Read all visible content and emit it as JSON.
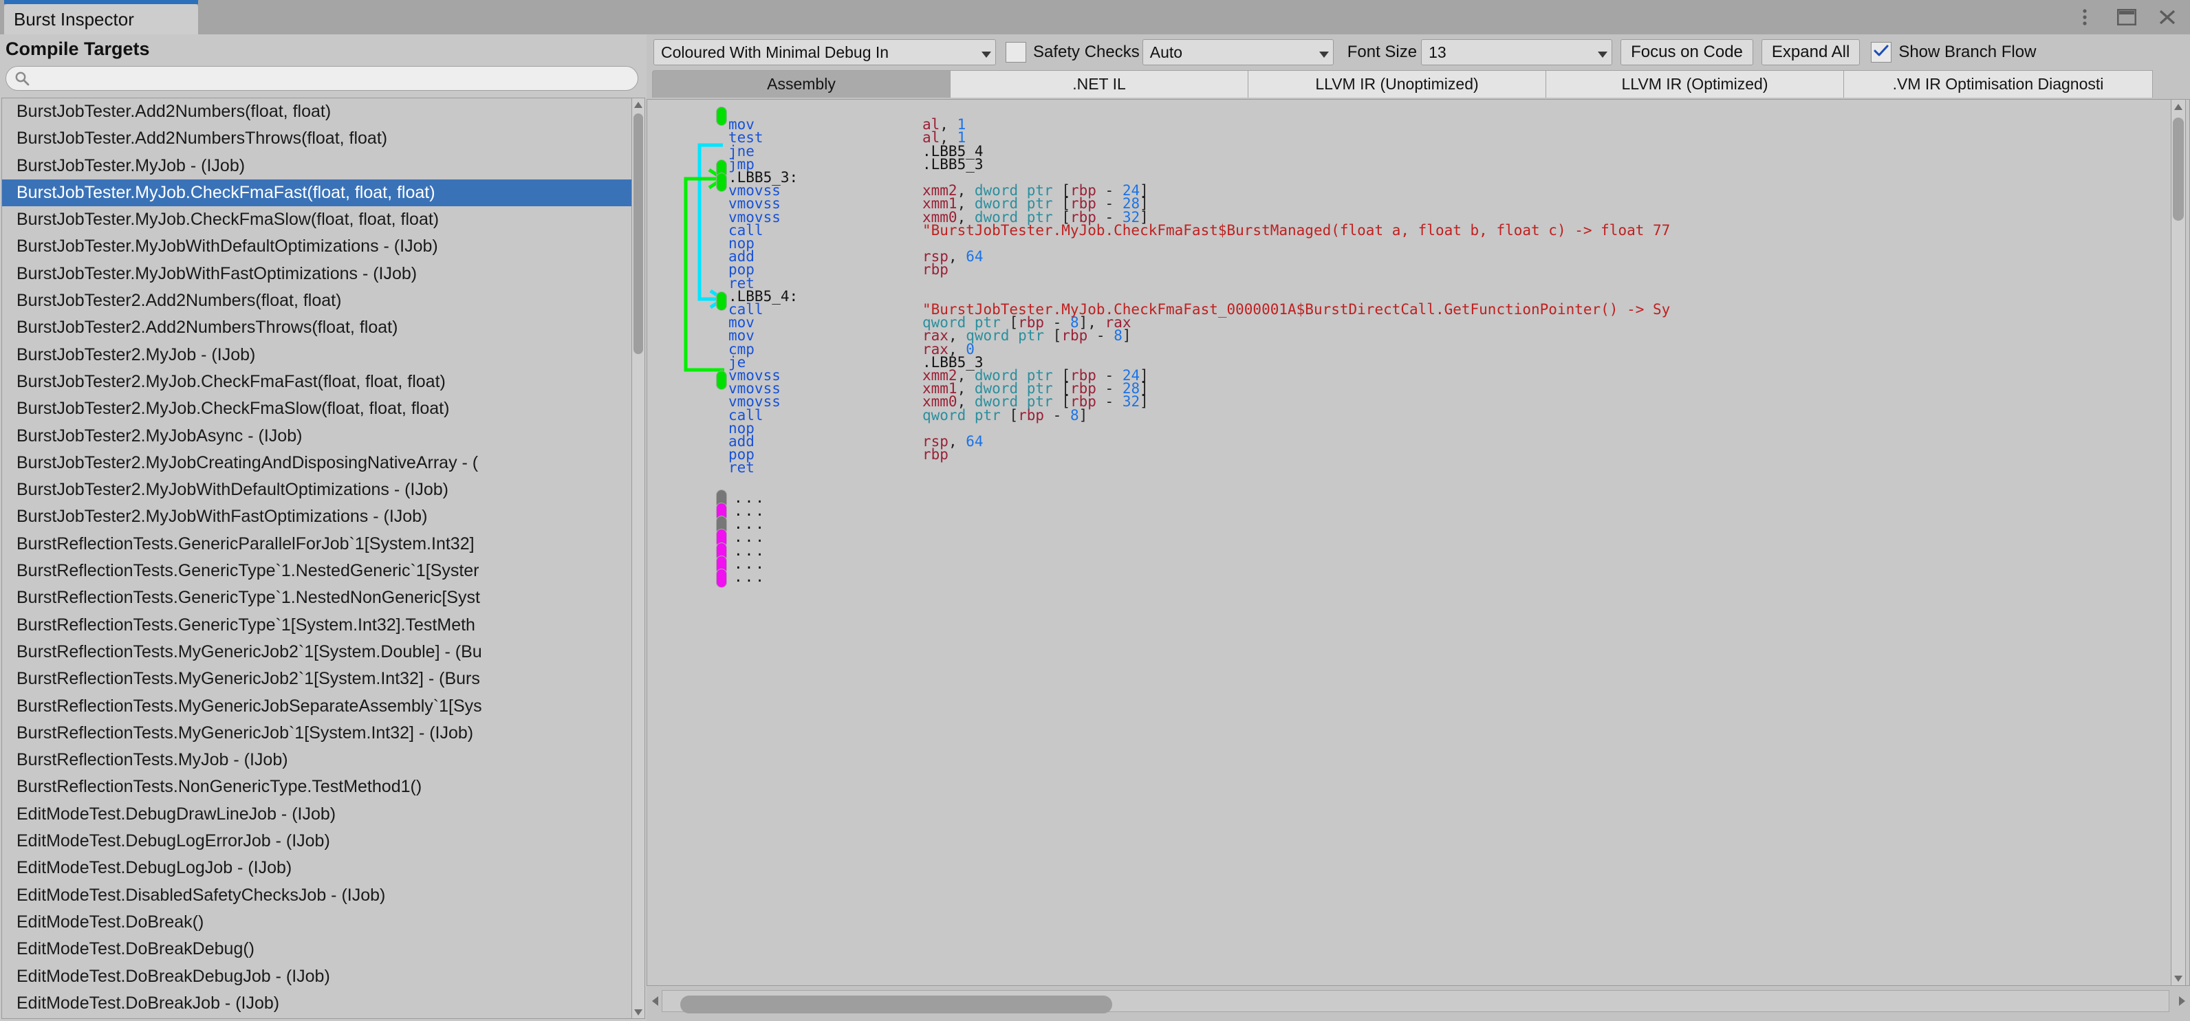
{
  "window": {
    "tab_title": "Burst Inspector",
    "buttons": [
      {
        "name": "kebab-menu",
        "icon": "kebab-menu-icon"
      },
      {
        "name": "maximize",
        "icon": "maximize-icon"
      },
      {
        "name": "close",
        "icon": "close-icon"
      }
    ]
  },
  "sidebar": {
    "title": "Compile Targets",
    "search": {
      "value": "",
      "placeholder": "",
      "icon": "search-icon"
    },
    "selected_index": 3,
    "items": [
      "BurstJobTester.Add2Numbers(float, float)",
      "BurstJobTester.Add2NumbersThrows(float, float)",
      "BurstJobTester.MyJob - (IJob)",
      "BurstJobTester.MyJob.CheckFmaFast(float, float, float)",
      "BurstJobTester.MyJob.CheckFmaSlow(float, float, float)",
      "BurstJobTester.MyJobWithDefaultOptimizations - (IJob)",
      "BurstJobTester.MyJobWithFastOptimizations - (IJob)",
      "BurstJobTester2.Add2Numbers(float, float)",
      "BurstJobTester2.Add2NumbersThrows(float, float)",
      "BurstJobTester2.MyJob - (IJob)",
      "BurstJobTester2.MyJob.CheckFmaFast(float, float, float)",
      "BurstJobTester2.MyJob.CheckFmaSlow(float, float, float)",
      "BurstJobTester2.MyJobAsync - (IJob)",
      "BurstJobTester2.MyJobCreatingAndDisposingNativeArray - (",
      "BurstJobTester2.MyJobWithDefaultOptimizations - (IJob)",
      "BurstJobTester2.MyJobWithFastOptimizations - (IJob)",
      "BurstReflectionTests.GenericParallelForJob`1[System.Int32]",
      "BurstReflectionTests.GenericType`1.NestedGeneric`1[Syster",
      "BurstReflectionTests.GenericType`1.NestedNonGeneric[Syst",
      "BurstReflectionTests.GenericType`1[System.Int32].TestMeth",
      "BurstReflectionTests.MyGenericJob2`1[System.Double] - (Bu",
      "BurstReflectionTests.MyGenericJob2`1[System.Int32] - (Burs",
      "BurstReflectionTests.MyGenericJobSeparateAssembly`1[Sys",
      "BurstReflectionTests.MyGenericJob`1[System.Int32] - (IJob)",
      "BurstReflectionTests.MyJob - (IJob)",
      "BurstReflectionTests.NonGenericType.TestMethod1()",
      "EditModeTest.DebugDrawLineJob - (IJob)",
      "EditModeTest.DebugLogErrorJob - (IJob)",
      "EditModeTest.DebugLogJob - (IJob)",
      "EditModeTest.DisabledSafetyChecksJob - (IJob)",
      "EditModeTest.DoBreak()",
      "EditModeTest.DoBreakDebug()",
      "EditModeTest.DoBreakDebugJob - (IJob)",
      "EditModeTest.DoBreakJob - (IJob)"
    ]
  },
  "toolbar": {
    "mode_dropdown": {
      "value": "Coloured With Minimal Debug In",
      "caret": "chevron-down-icon"
    },
    "safety_checks": {
      "label": "Safety Checks",
      "checked": false
    },
    "safety_dropdown": {
      "value": "Auto",
      "caret": "chevron-down-icon"
    },
    "font_size": {
      "label": "Font Size",
      "value": "13",
      "caret": "chevron-down-icon"
    },
    "focus_on_code": "Focus on Code",
    "expand_all": "Expand All",
    "show_branch_flow": {
      "label": "Show Branch Flow",
      "checked": true
    }
  },
  "ir_tabs": {
    "active_index": 0,
    "items": [
      "Assembly",
      ".NET IL",
      "LLVM IR (Unoptimized)",
      "LLVM IR (Optimized)",
      ".VM IR Optimisation Diagnosti"
    ]
  },
  "code": {
    "lines": [
      {
        "pill": "green",
        "kind": "blank"
      },
      {
        "kind": "instr",
        "mnemonic": "mov",
        "operands": [
          {
            "t": "reg",
            "v": "al"
          },
          {
            "t": "punc",
            "v": ", "
          },
          {
            "t": "num",
            "v": "1"
          }
        ]
      },
      {
        "kind": "instr",
        "mnemonic": "test",
        "operands": [
          {
            "t": "reg",
            "v": "al"
          },
          {
            "t": "punc",
            "v": ", "
          },
          {
            "t": "num",
            "v": "1"
          }
        ]
      },
      {
        "kind": "instr",
        "mnemonic": "jne",
        "operands": [
          {
            "t": "lbl",
            "v": ".LBB5_4"
          }
        ]
      },
      {
        "pill": "green",
        "kind": "instr",
        "mnemonic": "jmp",
        "operands": [
          {
            "t": "lbl",
            "v": ".LBB5_3"
          }
        ]
      },
      {
        "pill": "green",
        "kind": "label",
        "label": ".LBB5_3:"
      },
      {
        "kind": "instr",
        "mnemonic": "vmovss",
        "operands": [
          {
            "t": "reg",
            "v": "xmm2"
          },
          {
            "t": "punc",
            "v": ", "
          },
          {
            "t": "ptr",
            "v": "dword ptr "
          },
          {
            "t": "punc",
            "v": "["
          },
          {
            "t": "reg",
            "v": "rbp"
          },
          {
            "t": "punc",
            "v": " - "
          },
          {
            "t": "num",
            "v": "24"
          },
          {
            "t": "punc",
            "v": "]"
          }
        ]
      },
      {
        "kind": "instr",
        "mnemonic": "vmovss",
        "operands": [
          {
            "t": "reg",
            "v": "xmm1"
          },
          {
            "t": "punc",
            "v": ", "
          },
          {
            "t": "ptr",
            "v": "dword ptr "
          },
          {
            "t": "punc",
            "v": "["
          },
          {
            "t": "reg",
            "v": "rbp"
          },
          {
            "t": "punc",
            "v": " - "
          },
          {
            "t": "num",
            "v": "28"
          },
          {
            "t": "punc",
            "v": "]"
          }
        ]
      },
      {
        "kind": "instr",
        "mnemonic": "vmovss",
        "operands": [
          {
            "t": "reg",
            "v": "xmm0"
          },
          {
            "t": "punc",
            "v": ", "
          },
          {
            "t": "ptr",
            "v": "dword ptr "
          },
          {
            "t": "punc",
            "v": "["
          },
          {
            "t": "reg",
            "v": "rbp"
          },
          {
            "t": "punc",
            "v": " - "
          },
          {
            "t": "num",
            "v": "32"
          },
          {
            "t": "punc",
            "v": "]"
          }
        ]
      },
      {
        "kind": "instr",
        "mnemonic": "call",
        "operands": [
          {
            "t": "str",
            "v": "\"BurstJobTester.MyJob.CheckFmaFast$BurstManaged(float a, float b, float c) -> float 77"
          }
        ]
      },
      {
        "kind": "instr",
        "mnemonic": "nop",
        "operands": []
      },
      {
        "kind": "instr",
        "mnemonic": "add",
        "operands": [
          {
            "t": "reg",
            "v": "rsp"
          },
          {
            "t": "punc",
            "v": ", "
          },
          {
            "t": "num",
            "v": "64"
          }
        ]
      },
      {
        "kind": "instr",
        "mnemonic": "pop",
        "operands": [
          {
            "t": "reg",
            "v": "rbp"
          }
        ]
      },
      {
        "kind": "instr",
        "mnemonic": "ret",
        "operands": []
      },
      {
        "pill": "green",
        "kind": "label",
        "label": ".LBB5_4:"
      },
      {
        "kind": "instr",
        "mnemonic": "call",
        "operands": [
          {
            "t": "str",
            "v": "\"BurstJobTester.MyJob.CheckFmaFast_0000001A$BurstDirectCall.GetFunctionPointer() -> Sy"
          }
        ]
      },
      {
        "kind": "instr",
        "mnemonic": "mov",
        "operands": [
          {
            "t": "ptr",
            "v": "qword ptr "
          },
          {
            "t": "punc",
            "v": "["
          },
          {
            "t": "reg",
            "v": "rbp"
          },
          {
            "t": "punc",
            "v": " - "
          },
          {
            "t": "num",
            "v": "8"
          },
          {
            "t": "punc",
            "v": "], "
          },
          {
            "t": "reg",
            "v": "rax"
          }
        ]
      },
      {
        "kind": "instr",
        "mnemonic": "mov",
        "operands": [
          {
            "t": "reg",
            "v": "rax"
          },
          {
            "t": "punc",
            "v": ", "
          },
          {
            "t": "ptr",
            "v": "qword ptr "
          },
          {
            "t": "punc",
            "v": "["
          },
          {
            "t": "reg",
            "v": "rbp"
          },
          {
            "t": "punc",
            "v": " - "
          },
          {
            "t": "num",
            "v": "8"
          },
          {
            "t": "punc",
            "v": "]"
          }
        ]
      },
      {
        "kind": "instr",
        "mnemonic": "cmp",
        "operands": [
          {
            "t": "reg",
            "v": "rax"
          },
          {
            "t": "punc",
            "v": ", "
          },
          {
            "t": "num",
            "v": "0"
          }
        ]
      },
      {
        "kind": "instr",
        "mnemonic": "je",
        "operands": [
          {
            "t": "lbl",
            "v": ".LBB5_3"
          }
        ]
      },
      {
        "pill": "green",
        "kind": "instr",
        "mnemonic": "vmovss",
        "operands": [
          {
            "t": "reg",
            "v": "xmm2"
          },
          {
            "t": "punc",
            "v": ", "
          },
          {
            "t": "ptr",
            "v": "dword ptr "
          },
          {
            "t": "punc",
            "v": "["
          },
          {
            "t": "reg",
            "v": "rbp"
          },
          {
            "t": "punc",
            "v": " - "
          },
          {
            "t": "num",
            "v": "24"
          },
          {
            "t": "punc",
            "v": "]"
          }
        ]
      },
      {
        "kind": "instr",
        "mnemonic": "vmovss",
        "operands": [
          {
            "t": "reg",
            "v": "xmm1"
          },
          {
            "t": "punc",
            "v": ", "
          },
          {
            "t": "ptr",
            "v": "dword ptr "
          },
          {
            "t": "punc",
            "v": "["
          },
          {
            "t": "reg",
            "v": "rbp"
          },
          {
            "t": "punc",
            "v": " - "
          },
          {
            "t": "num",
            "v": "28"
          },
          {
            "t": "punc",
            "v": "]"
          }
        ]
      },
      {
        "kind": "instr",
        "mnemonic": "vmovss",
        "operands": [
          {
            "t": "reg",
            "v": "xmm0"
          },
          {
            "t": "punc",
            "v": ", "
          },
          {
            "t": "ptr",
            "v": "dword ptr "
          },
          {
            "t": "punc",
            "v": "["
          },
          {
            "t": "reg",
            "v": "rbp"
          },
          {
            "t": "punc",
            "v": " - "
          },
          {
            "t": "num",
            "v": "32"
          },
          {
            "t": "punc",
            "v": "]"
          }
        ]
      },
      {
        "kind": "instr",
        "mnemonic": "call",
        "operands": [
          {
            "t": "ptr",
            "v": "qword ptr "
          },
          {
            "t": "punc",
            "v": "["
          },
          {
            "t": "reg",
            "v": "rbp"
          },
          {
            "t": "punc",
            "v": " - "
          },
          {
            "t": "num",
            "v": "8"
          },
          {
            "t": "punc",
            "v": "]"
          }
        ]
      },
      {
        "kind": "instr",
        "mnemonic": "nop",
        "operands": []
      },
      {
        "kind": "instr",
        "mnemonic": "add",
        "operands": [
          {
            "t": "reg",
            "v": "rsp"
          },
          {
            "t": "punc",
            "v": ", "
          },
          {
            "t": "num",
            "v": "64"
          }
        ]
      },
      {
        "kind": "instr",
        "mnemonic": "pop",
        "operands": [
          {
            "t": "reg",
            "v": "rbp"
          }
        ]
      },
      {
        "kind": "instr",
        "mnemonic": "ret",
        "operands": []
      },
      {
        "kind": "blank"
      },
      {
        "pill": "gray",
        "kind": "folded",
        "text": "..."
      },
      {
        "pill": "magenta",
        "kind": "folded",
        "text": "..."
      },
      {
        "pill": "gray",
        "kind": "folded",
        "text": "..."
      },
      {
        "pill": "magenta",
        "kind": "folded",
        "text": "..."
      },
      {
        "pill": "magenta",
        "kind": "folded",
        "text": "..."
      },
      {
        "pill": "magenta",
        "kind": "folded",
        "text": "..."
      },
      {
        "pill": "magenta",
        "kind": "folded",
        "text": "..."
      }
    ]
  },
  "colors": {
    "selection_blue": "#3a72b8",
    "mnemonic": "#1752d8",
    "register": "#9a2035",
    "number": "#1a73e8",
    "pointer": "#2a8f9e",
    "string": "#c02020",
    "branch_green": "#00ef00",
    "branch_cyan": "#00e5ff",
    "pill_magenta": "#f010f0"
  }
}
